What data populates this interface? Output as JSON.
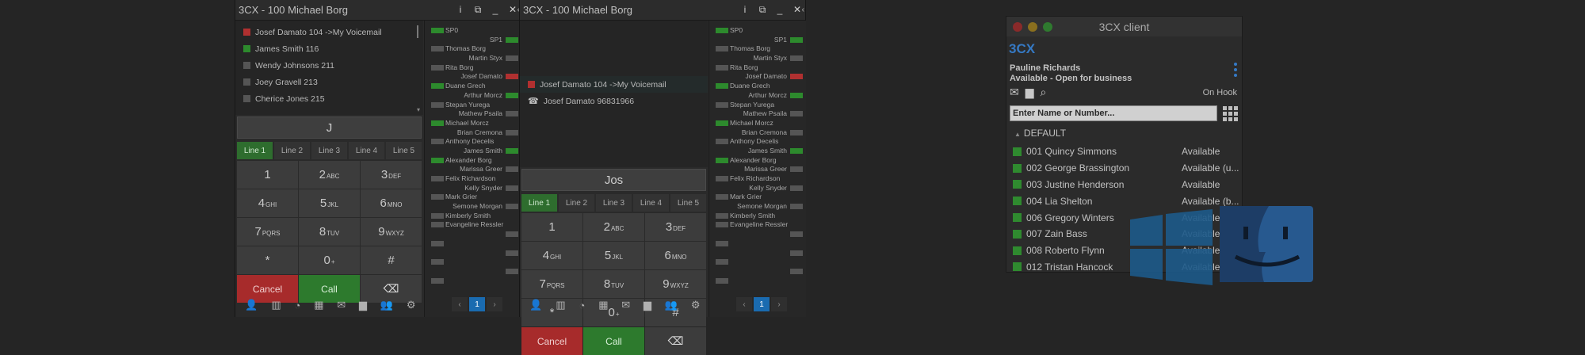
{
  "dialers": [
    {
      "title": "3CX - 100 Michael Borg",
      "contacts": [
        {
          "name": "Josef Damato  104  ->My Voicemail",
          "status": "red"
        },
        {
          "name": "James Smith  116",
          "status": "green"
        },
        {
          "name": "Wendy Johnsons  211",
          "status": "grey"
        },
        {
          "name": "Joey Gravell  213",
          "status": "grey"
        },
        {
          "name": "Cherice Jones  215",
          "status": "grey"
        }
      ],
      "entry": "J",
      "cancel_label": "Cancel",
      "call_label": "Call"
    },
    {
      "title": "3CX - 100 Michael Borg",
      "contacts": [
        {
          "name": "Josef Damato  104  ->My Voicemail",
          "status": "red"
        },
        {
          "name": "Josef Damato  96831966",
          "status": "phone"
        }
      ],
      "entry": "Jos",
      "cancel_label": "Cancel",
      "call_label": "Call"
    }
  ],
  "lines": [
    "Line 1",
    "Line 2",
    "Line 3",
    "Line 4",
    "Line 5"
  ],
  "keys": [
    {
      "digit": "1",
      "letters": ""
    },
    {
      "digit": "2",
      "letters": "ABC"
    },
    {
      "digit": "3",
      "letters": "DEF"
    },
    {
      "digit": "4",
      "letters": "GHI"
    },
    {
      "digit": "5",
      "letters": "JKL"
    },
    {
      "digit": "6",
      "letters": "MNO"
    },
    {
      "digit": "7",
      "letters": "PQRS"
    },
    {
      "digit": "8",
      "letters": "TUV"
    },
    {
      "digit": "9",
      "letters": "WXYZ"
    },
    {
      "digit": "*",
      "letters": ""
    },
    {
      "digit": "0",
      "letters": "+"
    },
    {
      "digit": "#",
      "letters": ""
    }
  ],
  "bottom_icons": [
    "contact-add-icon",
    "phonebook-icon",
    "history-icon",
    "apps-icon",
    "voicemail-icon",
    "chat-icon",
    "people-icon",
    "settings-icon"
  ],
  "blf": [
    {
      "name": "SP0",
      "side": "left",
      "status": "green"
    },
    {
      "name": "SP1",
      "side": "right",
      "status": "green"
    },
    {
      "name": "Thomas Borg",
      "side": "left",
      "status": "grey"
    },
    {
      "name": "Martin Styx",
      "side": "right",
      "status": "grey"
    },
    {
      "name": "Rita Borg",
      "side": "left",
      "status": "grey"
    },
    {
      "name": "Josef Damato",
      "side": "right",
      "status": "red"
    },
    {
      "name": "Duane Grech",
      "side": "left",
      "status": "green"
    },
    {
      "name": "Arthur Morcz",
      "side": "right",
      "status": "green"
    },
    {
      "name": "Stepan Yurega",
      "side": "left",
      "status": "grey"
    },
    {
      "name": "Mathew Psaila",
      "side": "right",
      "status": "grey"
    },
    {
      "name": "Michael Morcz",
      "side": "left",
      "status": "green"
    },
    {
      "name": "Brian Cremona",
      "side": "right",
      "status": "grey"
    },
    {
      "name": "Anthony Decelis",
      "side": "left",
      "status": "grey"
    },
    {
      "name": "James Smith",
      "side": "right",
      "status": "green"
    },
    {
      "name": "Alexander Borg",
      "side": "left",
      "status": "green"
    },
    {
      "name": "Marissa Greer",
      "side": "right",
      "status": "grey"
    },
    {
      "name": "Felix Richardson",
      "side": "left",
      "status": "grey"
    },
    {
      "name": "Kelly Snyder",
      "side": "right",
      "status": "grey"
    },
    {
      "name": "Mark Grier",
      "side": "left",
      "status": "grey"
    },
    {
      "name": "Semone Morgan",
      "side": "right",
      "status": "grey"
    },
    {
      "name": "Kimberly Smith",
      "side": "left",
      "status": "grey"
    },
    {
      "name": "Evangeline Ressler",
      "side": "left",
      "status": "grey"
    },
    {
      "name": "",
      "side": "right",
      "status": "grey"
    },
    {
      "name": "",
      "side": "left",
      "status": "grey"
    },
    {
      "name": "",
      "side": "right",
      "status": "grey"
    },
    {
      "name": "",
      "side": "left",
      "status": "grey"
    },
    {
      "name": "",
      "side": "right",
      "status": "grey"
    },
    {
      "name": "",
      "side": "left",
      "status": "grey"
    }
  ],
  "pager": {
    "prev": "‹",
    "current": "1",
    "next": "›"
  },
  "mac_client": {
    "title": "3CX client",
    "logo": "3CX",
    "user_name": "Pauline Richards",
    "user_status": "Available - Open for business",
    "hook_status": "On Hook",
    "search_placeholder": "Enter Name or Number...",
    "group_name": "DEFAULT",
    "contacts": [
      {
        "name": "001 Quincy Simmons",
        "status": "Available"
      },
      {
        "name": "002 George Brassington",
        "status": "Available (u..."
      },
      {
        "name": "003 Justine Henderson",
        "status": "Available"
      },
      {
        "name": "004 Lia Shelton",
        "status": "Available (b..."
      },
      {
        "name": "006 Gregory Winters",
        "status": "Available"
      },
      {
        "name": "007 Zain Bass",
        "status": "Available"
      },
      {
        "name": "008 Roberto Flynn",
        "status": "Available"
      },
      {
        "name": "012 Tristan Hancock",
        "status": "Available"
      }
    ]
  },
  "colors": {
    "green": "#2d8a2d",
    "red": "#b03030",
    "grey": "#555555",
    "accent": "#1a6bb0"
  }
}
